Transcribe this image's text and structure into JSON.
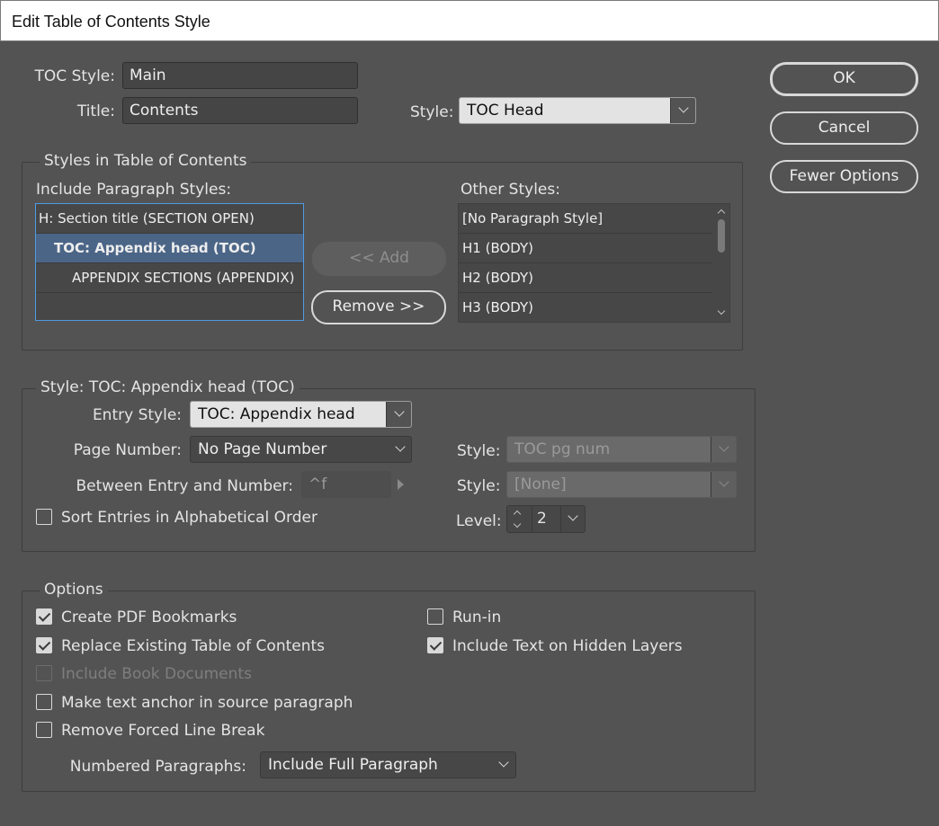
{
  "window": {
    "title": "Edit Table of Contents Style"
  },
  "top": {
    "toc_style_label": "TOC Style:",
    "toc_style_value": "Main",
    "title_label": "Title:",
    "title_value": "Contents",
    "style_label": "Style:",
    "style_value": "TOC Head"
  },
  "buttons": {
    "ok": "OK",
    "cancel": "Cancel",
    "fewer_options": "Fewer Options",
    "add": "<< Add",
    "remove": "Remove >>"
  },
  "styles_group": {
    "legend": "Styles in Table of Contents",
    "include_label": "Include Paragraph Styles:",
    "include_items": [
      "H: Section title (SECTION OPEN)",
      "TOC: Appendix head (TOC)",
      "APPENDIX SECTIONS (APPENDIX)"
    ],
    "selected_include_index": 1,
    "other_label": "Other Styles:",
    "other_items": [
      "[No Paragraph Style]",
      "H1 (BODY)",
      "H2 (BODY)",
      "H3 (BODY)"
    ]
  },
  "style_group": {
    "legend": "Style: TOC: Appendix head (TOC)",
    "entry_style_label": "Entry Style:",
    "entry_style_value": "TOC: Appendix head",
    "page_number_label": "Page Number:",
    "page_number_value": "No Page Number",
    "between_label": "Between Entry and Number:",
    "between_value": "^f",
    "style1_label": "Style:",
    "style1_value": "TOC pg num",
    "style2_label": "Style:",
    "style2_value": "[None]",
    "sort_label": "Sort Entries in Alphabetical Order",
    "sort_checked": false,
    "level_label": "Level:",
    "level_value": "2"
  },
  "options_group": {
    "legend": "Options",
    "create_pdf_bookmarks": {
      "label": "Create PDF Bookmarks",
      "checked": true
    },
    "replace_existing": {
      "label": "Replace Existing Table of Contents",
      "checked": true
    },
    "include_book_documents": {
      "label": "Include Book Documents",
      "checked": false,
      "disabled": true
    },
    "make_text_anchor": {
      "label": "Make text anchor in source paragraph",
      "checked": false
    },
    "remove_forced_line_break": {
      "label": "Remove Forced Line Break",
      "checked": false
    },
    "run_in": {
      "label": "Run-in",
      "checked": false
    },
    "include_hidden_layers": {
      "label": "Include Text on Hidden Layers",
      "checked": true
    },
    "numbered_paragraphs_label": "Numbered Paragraphs:",
    "numbered_paragraphs_value": "Include Full Paragraph"
  },
  "colors": {
    "dialog_bg": "#535353",
    "selection": "#4b6587",
    "focus_border": "#4f9be4"
  }
}
